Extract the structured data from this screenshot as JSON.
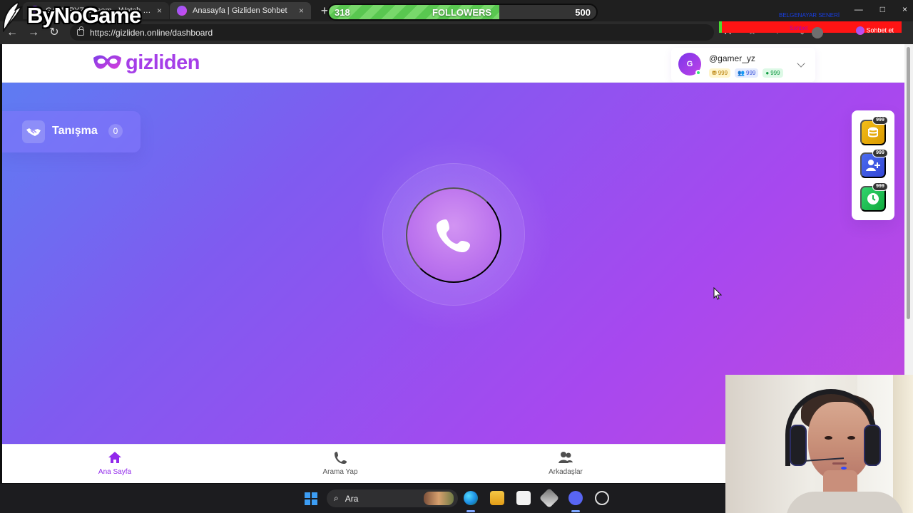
{
  "stream_overlay": {
    "logo_text": "ByNoGame",
    "followers": {
      "current": "318",
      "label": "FOLLOWERS",
      "goal": "500",
      "progress": 0.636
    },
    "ticker_1": "BELGENAYAR SENERİ",
    "ticker_2": "Sohbet"
  },
  "browser": {
    "tabs": [
      {
        "title": "GAMERYZ Stream - Watch Live",
        "close": "×"
      },
      {
        "title": "Anasayfa | Gizliden Sohbet",
        "close": "×"
      }
    ],
    "new_tab": "+",
    "url": "https://gizliden.online/dashboard",
    "mini_chat": "Sohbet et"
  },
  "app": {
    "brand": "gizliden",
    "profile": {
      "avatar_initial": "G",
      "username": "@gamer_yz",
      "coins": "999",
      "friends": "999",
      "time": "999"
    },
    "intro": {
      "label": "Tanışma",
      "count": "0"
    },
    "quick_actions": [
      {
        "name": "coins",
        "badge": "999"
      },
      {
        "name": "add-friend",
        "badge": "999"
      },
      {
        "name": "time",
        "badge": "999"
      }
    ],
    "bottom_nav": [
      {
        "label": "Ana Sayfa",
        "active": true
      },
      {
        "label": "Arama Yap",
        "active": false
      },
      {
        "label": "Arkadaşlar",
        "active": false
      }
    ],
    "colors": {
      "brand": "#a53ee8",
      "hero_start": "#5e7cf2",
      "hero_end": "#c149df",
      "active_nav": "#9128eb"
    }
  },
  "taskbar": {
    "search_placeholder": "Ara"
  }
}
